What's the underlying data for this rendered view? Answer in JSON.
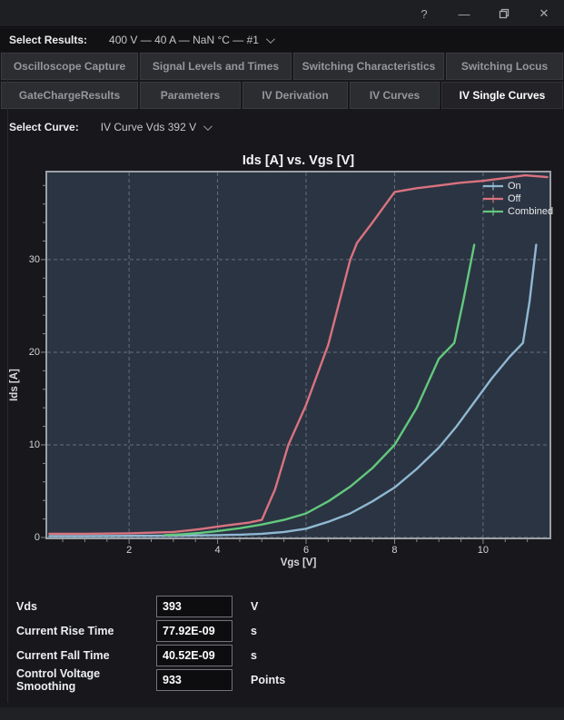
{
  "titlebar": {
    "help_glyph": "?",
    "minimize_glyph": "—",
    "close_glyph": "✕"
  },
  "results_bar": {
    "label": "Select Results:",
    "value": "400 V — 40 A — NaN °C — #1"
  },
  "tabs_row1": [
    {
      "label": "Oscilloscope Capture"
    },
    {
      "label": "Signal Levels and Times"
    },
    {
      "label": "Switching Characteristics"
    },
    {
      "label": "Switching Locus"
    }
  ],
  "tabs_row2": [
    {
      "label": "GateChargeResults"
    },
    {
      "label": "Parameters"
    },
    {
      "label": "IV Derivation"
    },
    {
      "label": "IV Curves"
    },
    {
      "label": "IV Single Curves",
      "active": true
    }
  ],
  "curve_bar": {
    "label": "Select Curve:",
    "value": "IV Curve Vds 392 V"
  },
  "chart_data": {
    "type": "line",
    "title": "Ids [A] vs. Vgs [V]",
    "xlabel": "Vgs [V]",
    "ylabel": "Ids [A]",
    "xlim": [
      0.15,
      11.5
    ],
    "ylim": [
      0,
      39.4
    ],
    "xticks": [
      2,
      4,
      6,
      8,
      10
    ],
    "yticks": [
      0,
      10,
      20,
      30
    ],
    "x_minor_step": 0.5,
    "y_minor_step": 2,
    "grid": "dashed",
    "grid_color": "#99a0a8",
    "plot_bg": "#2b3442",
    "legend_position": "top-right",
    "series": [
      {
        "name": "On",
        "color": "#8fb8d2",
        "x": [
          0.2,
          1,
          2,
          3,
          4,
          4.5,
          5,
          5.5,
          6,
          6.5,
          7,
          7.5,
          8,
          8.5,
          9,
          9.4,
          9.8,
          10.2,
          10.6,
          10.9,
          11.05,
          11.2
        ],
        "y": [
          0.15,
          0.15,
          0.18,
          0.2,
          0.25,
          0.3,
          0.4,
          0.6,
          0.95,
          1.7,
          2.6,
          3.9,
          5.4,
          7.4,
          9.7,
          12.0,
          14.6,
          17.2,
          19.5,
          21.0,
          25.5,
          31.6
        ]
      },
      {
        "name": "Off",
        "color": "#d9737f",
        "x": [
          0.2,
          1,
          2,
          3,
          3.6,
          4.2,
          4.7,
          5.0,
          5.3,
          5.6,
          6.0,
          6.5,
          7.0,
          7.15,
          7.5,
          8.0,
          8.5,
          9.0,
          9.5,
          10.0,
          10.5,
          10.95,
          11.45
        ],
        "y": [
          0.4,
          0.4,
          0.45,
          0.6,
          0.9,
          1.3,
          1.6,
          1.9,
          5.2,
          10.0,
          14.3,
          20.8,
          30.0,
          31.8,
          34.0,
          37.3,
          37.7,
          38.0,
          38.3,
          38.5,
          38.8,
          39.1,
          38.9
        ]
      },
      {
        "name": "Combined",
        "color": "#63c87e",
        "x": [
          2.8,
          3.2,
          3.6,
          4.0,
          4.5,
          5.0,
          5.5,
          6.0,
          6.5,
          7.0,
          7.5,
          8.0,
          8.5,
          9.0,
          9.35,
          9.55,
          9.8
        ],
        "y": [
          0.25,
          0.35,
          0.5,
          0.7,
          1.0,
          1.4,
          1.9,
          2.6,
          3.9,
          5.5,
          7.5,
          10.0,
          14.0,
          19.3,
          21.0,
          25.5,
          31.6
        ]
      }
    ]
  },
  "form": {
    "rows": [
      {
        "label": "Vds",
        "value": "393",
        "unit": "V"
      },
      {
        "label": "Current Rise Time",
        "value": "77.92E-09",
        "unit": "s"
      },
      {
        "label": "Current Fall Time",
        "value": "40.52E-09",
        "unit": "s"
      },
      {
        "label": "Control Voltage Smoothing",
        "value": "933",
        "unit": "Points"
      }
    ]
  }
}
